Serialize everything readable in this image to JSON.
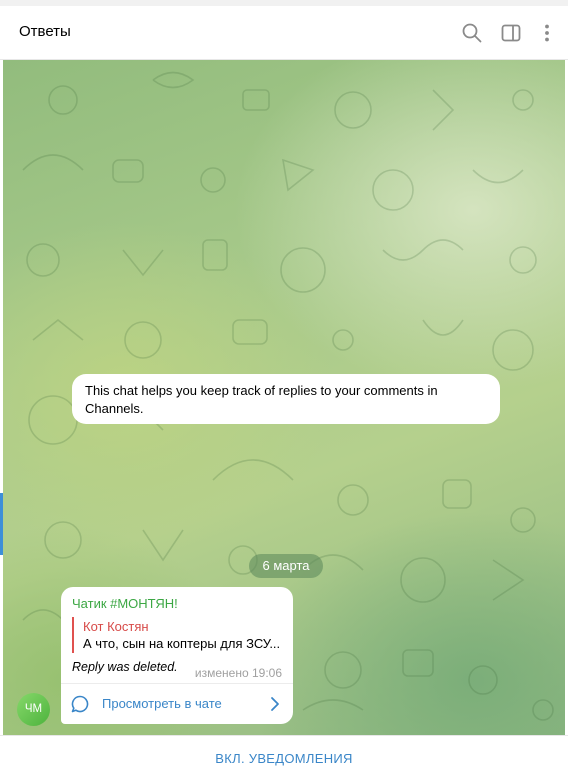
{
  "header": {
    "title": "Ответы",
    "icons": [
      "search-icon",
      "sidebar-toggle-icon",
      "more-vertical-icon"
    ]
  },
  "colors": {
    "accent": "#3a86c8",
    "sender": "#3ca744",
    "reply_author": "#d74a48",
    "avatar": "#5ac24a"
  },
  "chat": {
    "system_message": "This chat helps you keep track of replies to your comments in Channels.",
    "date_chip": "6 марта",
    "message": {
      "avatar_initials": "ЧМ",
      "sender": "Чатик #МОНТЯН!",
      "reply": {
        "author": "Кот Костян",
        "text": "А что, сын на коптеры для ЗСУ..."
      },
      "body": "Reply was deleted.",
      "edited_label": "изменено",
      "time": "19:06",
      "view_in_chat": "Просмотреть в чате"
    }
  },
  "footer": {
    "notify_button": "ВКЛ. УВЕДОМЛЕНИЯ"
  }
}
